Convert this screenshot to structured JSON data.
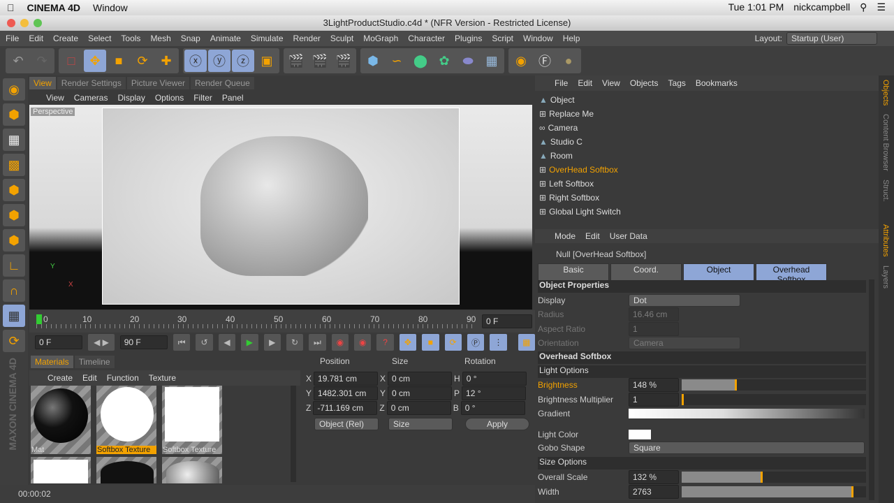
{
  "mac_menubar": {
    "app": "CINEMA 4D",
    "menu": "Window",
    "clock": "Tue 1:01 PM",
    "user": "nickcampbell"
  },
  "window_title": "3LightProductStudio.c4d * (NFR Version - Restricted License)",
  "app_menu": [
    "File",
    "Edit",
    "Create",
    "Select",
    "Tools",
    "Mesh",
    "Snap",
    "Animate",
    "Simulate",
    "Render",
    "Sculpt",
    "MoGraph",
    "Character",
    "Plugins",
    "Script",
    "Window",
    "Help"
  ],
  "layout": {
    "label": "Layout:",
    "value": "Startup (User)"
  },
  "view_tabs": [
    "View",
    "Render Settings",
    "Picture Viewer",
    "Render Queue"
  ],
  "view_menu": [
    "View",
    "Cameras",
    "Display",
    "Options",
    "Filter",
    "Panel"
  ],
  "viewport": {
    "camera_label": "Perspective",
    "axis_y": "Y",
    "axis_x": "X"
  },
  "timeline": {
    "ticks": [
      "0",
      "10",
      "20",
      "30",
      "40",
      "50",
      "60",
      "70",
      "80",
      "90"
    ],
    "current_frame": "0 F"
  },
  "transport": {
    "start": "0 F",
    "end": "90 F"
  },
  "materials": {
    "tabs": [
      "Materials",
      "Timeline"
    ],
    "menu": [
      "Create",
      "Edit",
      "Function",
      "Texture"
    ],
    "items": [
      {
        "name": "Mat"
      },
      {
        "name": "Softbox Texture"
      },
      {
        "name": "Softbox Texture"
      }
    ]
  },
  "coords": {
    "headers": [
      "Position",
      "Size",
      "Rotation"
    ],
    "rows": [
      {
        "pl": "X",
        "pv": "19.781 cm",
        "sl": "X",
        "sv": "0 cm",
        "rl": "H",
        "rv": "0 °"
      },
      {
        "pl": "Y",
        "pv": "1482.301 cm",
        "sl": "Y",
        "sv": "0 cm",
        "rl": "P",
        "rv": "12 °"
      },
      {
        "pl": "Z",
        "pv": "-711.169 cm",
        "sl": "Z",
        "sv": "0 cm",
        "rl": "B",
        "rv": "0 °"
      }
    ],
    "mode": "Object (Rel)",
    "size_mode": "Size",
    "apply": "Apply"
  },
  "status": "00:00:02",
  "logo": "MAXON CINEMA 4D",
  "object_manager": {
    "menu": [
      "File",
      "Edit",
      "View",
      "Objects",
      "Tags",
      "Bookmarks"
    ],
    "objects": [
      "Object",
      "Replace Me",
      "Camera",
      "Studio C",
      "Room",
      "OverHead Softbox",
      "Left Softbox",
      "Right Softbox",
      "Global Light Switch"
    ],
    "selected": "OverHead Softbox"
  },
  "attributes": {
    "menu": [
      "Mode",
      "Edit",
      "User Data"
    ],
    "object_title": "Null [OverHead Softbox]",
    "tabs": [
      "Basic",
      "Coord.",
      "Object",
      "Overhead Softbox"
    ],
    "object_properties": {
      "title": "Object Properties",
      "display_label": "Display",
      "display": "Dot",
      "radius_label": "Radius",
      "radius": "16.46 cm",
      "aspect_label": "Aspect Ratio",
      "aspect": "1",
      "orientation_label": "Orientation",
      "orientation": "Camera"
    },
    "softbox_title": "Overhead Softbox",
    "light_options": {
      "title": "Light Options",
      "brightness_label": "Brightness",
      "brightness": "148 %",
      "brightness_fraction": 0.3,
      "multiplier_label": "Brightness Multiplier",
      "multiplier": "1",
      "gradient_label": "Gradient",
      "light_color_label": "Light Color",
      "gobo_label": "Gobo Shape",
      "gobo": "Square"
    },
    "size_options": {
      "title": "Size Options",
      "scale_label": "Overall Scale",
      "scale": "132 %",
      "scale_fraction": 0.44,
      "width_label": "Width",
      "width": "2763",
      "width_fraction": 0.93
    }
  },
  "side_tabs": [
    "Objects",
    "Content Browser",
    "Struct.",
    "Attributes",
    "Layers"
  ],
  "colors": {
    "accent": "#f3a200",
    "selected_tab": "#8ea6d6"
  }
}
